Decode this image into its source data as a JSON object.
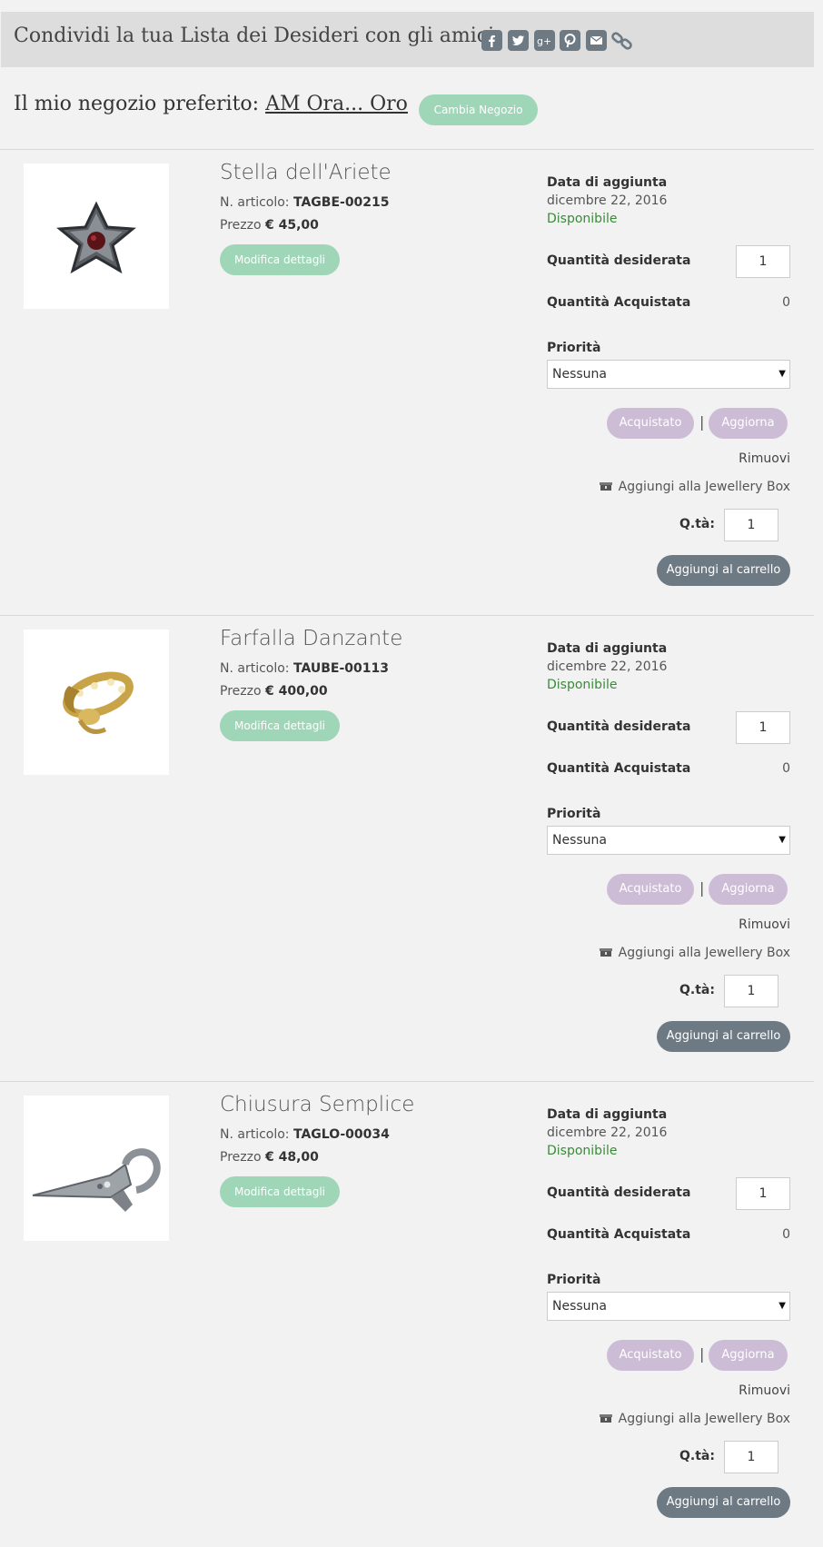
{
  "share": {
    "title": "Condividi la tua Lista dei Desideri con gli amici",
    "icons": [
      "facebook-icon",
      "twitter-icon",
      "google-plus-icon",
      "pinterest-icon",
      "email-icon",
      "link-icon"
    ]
  },
  "store": {
    "label": "Il mio negozio preferito:",
    "name": "AM Ora... Oro",
    "change_button": "Cambia Negozio"
  },
  "labels": {
    "article_prefix": "N. articolo:",
    "price_prefix": "Prezzo",
    "edit_details": "Modifica dettagli",
    "date_added": "Data di aggiunta",
    "qty_desired": "Quantità desiderata",
    "qty_purchased": "Quantità Acquistata",
    "priority": "Priorità",
    "purchased_btn": "Acquistato",
    "separator": "|",
    "update_btn": "Aggiorna",
    "remove": "Rimuovi",
    "jewellery_box": "Aggiungi alla Jewellery Box",
    "qty_short": "Q.tà:",
    "add_to_cart": "Aggiungi al carrello"
  },
  "items": [
    {
      "name": "Stella dell'Ariete",
      "article": "TAGBE-00215",
      "price": "€ 45,00",
      "date": "dicembre 22, 2016",
      "availability": "Disponibile",
      "qty_desired": "1",
      "qty_purchased": "0",
      "priority": "Nessuna",
      "cart_qty": "1"
    },
    {
      "name": "Farfalla Danzante",
      "article": "TAUBE-00113",
      "price": "€ 400,00",
      "date": "dicembre 22, 2016",
      "availability": "Disponibile",
      "qty_desired": "1",
      "qty_purchased": "0",
      "priority": "Nessuna",
      "cart_qty": "1"
    },
    {
      "name": "Chiusura Semplice",
      "article": "TAGLO-00034",
      "price": "€ 48,00",
      "date": "dicembre 22, 2016",
      "availability": "Disponibile",
      "qty_desired": "1",
      "qty_purchased": "0",
      "priority": "Nessuna",
      "cart_qty": "1"
    }
  ],
  "colors": {
    "green_button": "#9fd6b8",
    "purple_button": "#cdbcd6",
    "dark_button": "#6d7a84",
    "available_text": "#3b8a3b"
  }
}
